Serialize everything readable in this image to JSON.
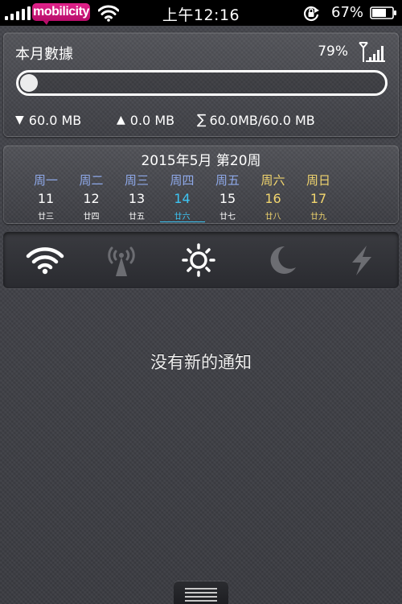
{
  "status_bar": {
    "carrier": "mobilicity",
    "time": "上午12:16",
    "battery_percent": "67%",
    "signal_bars": 5
  },
  "data_usage": {
    "title": "本月數據",
    "percent": "79%",
    "progress_fraction": 0.0,
    "download": "60.0 MB",
    "upload": "0.0 MB",
    "total": "60.0MB/60.0 MB"
  },
  "calendar": {
    "title": "2015年5月 第20周",
    "days": [
      {
        "weekday": "周一",
        "date": "11",
        "lunar": "廿三",
        "weekend": false,
        "today": false
      },
      {
        "weekday": "周二",
        "date": "12",
        "lunar": "廿四",
        "weekend": false,
        "today": false
      },
      {
        "weekday": "周三",
        "date": "13",
        "lunar": "廿五",
        "weekend": false,
        "today": false
      },
      {
        "weekday": "周四",
        "date": "14",
        "lunar": "廿六",
        "weekend": false,
        "today": true
      },
      {
        "weekday": "周五",
        "date": "15",
        "lunar": "廿七",
        "weekend": false,
        "today": false
      },
      {
        "weekday": "周六",
        "date": "16",
        "lunar": "廿八",
        "weekend": true,
        "today": false
      },
      {
        "weekday": "周日",
        "date": "17",
        "lunar": "廿九",
        "weekend": true,
        "today": false
      }
    ]
  },
  "toggles": [
    {
      "icon": "wifi-icon",
      "state": "on"
    },
    {
      "icon": "cellular-tower-icon",
      "state": "off"
    },
    {
      "icon": "brightness-sun-icon",
      "state": "on"
    },
    {
      "icon": "moon-icon",
      "state": "off"
    },
    {
      "icon": "lightning-icon",
      "state": "off"
    }
  ],
  "notifications": {
    "empty_message": "没有新的通知"
  },
  "colors": {
    "weekday": "#8ea8e8",
    "weekend": "#f1d56e",
    "today": "#3cc6f5",
    "carrier_brand": "#e0218a"
  }
}
